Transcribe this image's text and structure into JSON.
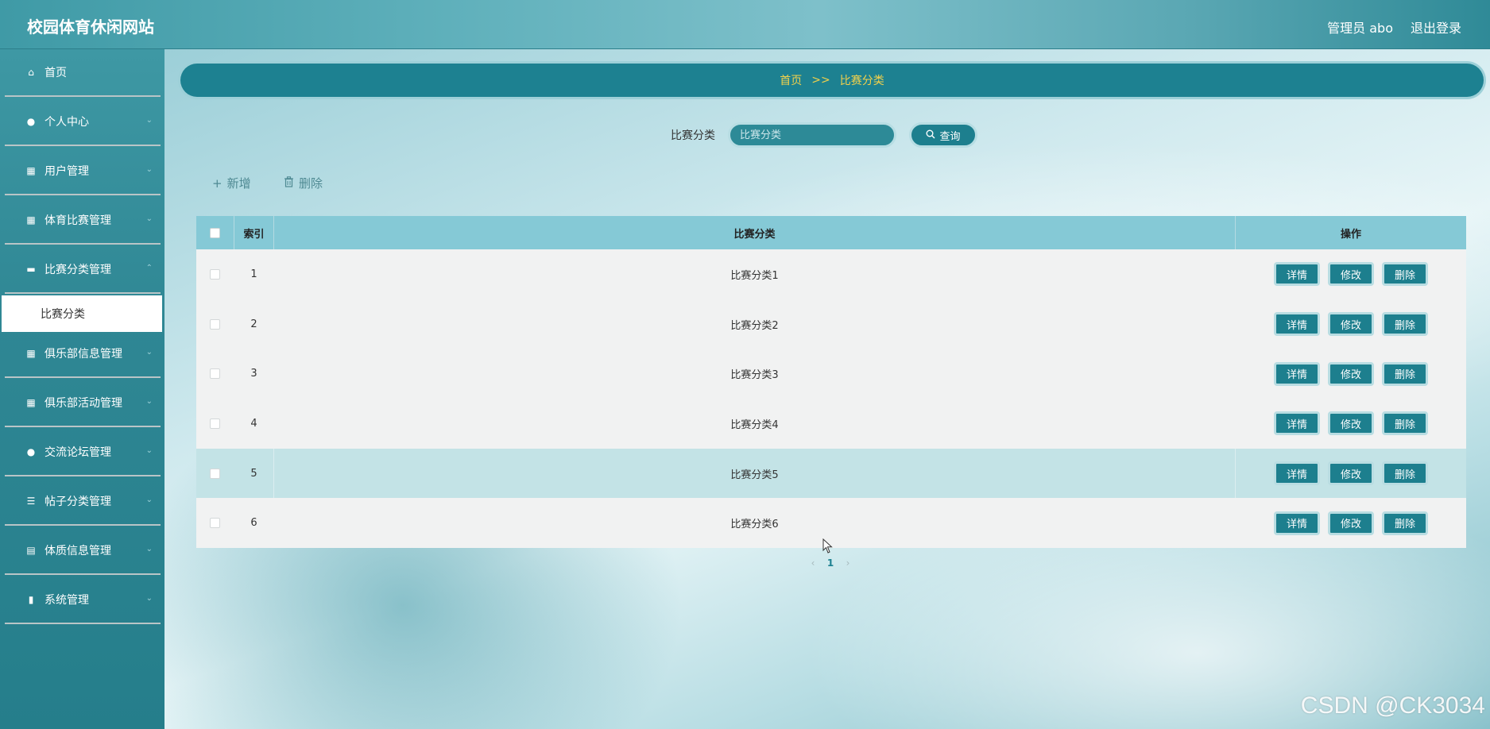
{
  "header": {
    "site_title": "校园体育休闲网站",
    "admin_name": "管理员 abo",
    "logout_label": "退出登录"
  },
  "sidebar": {
    "items": [
      {
        "label": "首页",
        "icon": "home-icon",
        "has_children": false
      },
      {
        "label": "个人中心",
        "icon": "user-icon",
        "has_children": true
      },
      {
        "label": "用户管理",
        "icon": "grid-icon",
        "has_children": true
      },
      {
        "label": "体育比赛管理",
        "icon": "grid-icon",
        "has_children": true
      },
      {
        "label": "比赛分类管理",
        "icon": "ticket-icon",
        "has_children": true
      },
      {
        "label": "俱乐部信息管理",
        "icon": "grid-icon",
        "has_children": true
      },
      {
        "label": "俱乐部活动管理",
        "icon": "grid-icon",
        "has_children": true
      },
      {
        "label": "交流论坛管理",
        "icon": "user-icon",
        "has_children": true
      },
      {
        "label": "帖子分类管理",
        "icon": "list-icon",
        "has_children": true
      },
      {
        "label": "体质信息管理",
        "icon": "table-icon",
        "has_children": true
      },
      {
        "label": "系统管理",
        "icon": "bar-chart-icon",
        "has_children": true
      }
    ],
    "active_sub_item": "比赛分类"
  },
  "breadcrumb": {
    "home": "首页",
    "separator": ">>",
    "current": "比赛分类"
  },
  "search": {
    "label": "比赛分类",
    "placeholder": "比赛分类",
    "button_label": "查询"
  },
  "actions": {
    "add_label": "新增",
    "delete_label": "删除"
  },
  "table": {
    "headers": {
      "index": "索引",
      "name": "比赛分类",
      "ops": "操作"
    },
    "rows": [
      {
        "index": "1",
        "name": "比赛分类1"
      },
      {
        "index": "2",
        "name": "比赛分类2"
      },
      {
        "index": "3",
        "name": "比赛分类3"
      },
      {
        "index": "4",
        "name": "比赛分类4"
      },
      {
        "index": "5",
        "name": "比赛分类5"
      },
      {
        "index": "6",
        "name": "比赛分类6"
      }
    ],
    "row_ops": {
      "detail": "详情",
      "edit": "修改",
      "delete": "删除"
    }
  },
  "pagination": {
    "prev": "‹",
    "current_page": "1",
    "next": "›"
  },
  "watermark": "CSDN @CK3034",
  "colors": {
    "accent": "#1d8191",
    "breadcrumb_text": "#f2d14b"
  }
}
